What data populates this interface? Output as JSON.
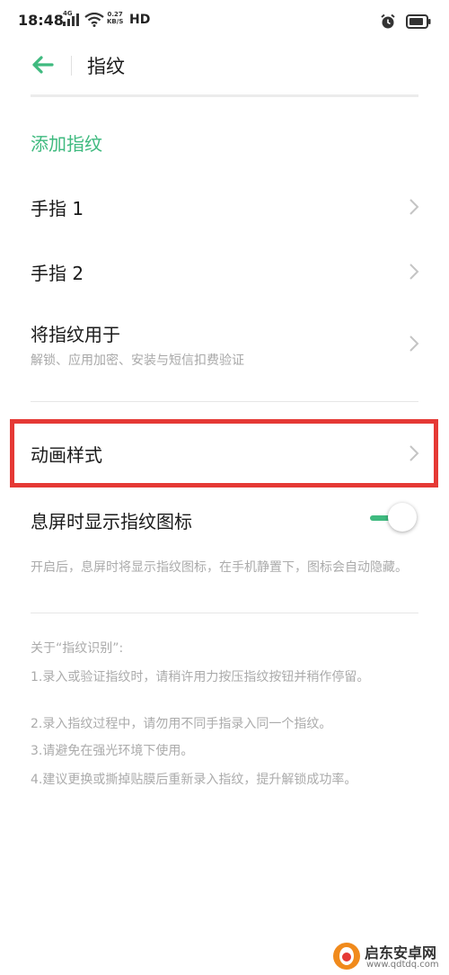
{
  "status_bar": {
    "time": "18:48",
    "network": "4G",
    "speed_value": "0.27",
    "speed_unit": "KB/S",
    "hd": "HD"
  },
  "header": {
    "title": "指纹"
  },
  "add_fingerprint_label": "添加指纹",
  "items": [
    {
      "label": "手指 1"
    },
    {
      "label": "手指 2"
    },
    {
      "label": "将指纹用于",
      "sub": "解锁、应用加密、安装与短信扣费验证"
    },
    {
      "label": "动画样式"
    }
  ],
  "toggle_row": {
    "label": "息屏时显示指纹图标",
    "enabled": true,
    "description": "开启后，息屏时将显示指纹图标，在手机静置下，图标会自动隐藏。"
  },
  "about": {
    "title": "关于“指纹识别”:",
    "tips": [
      "1.录入或验证指纹时，请稍许用力按压指纹按钮并稍作停留。",
      "2.录入指纹过程中，请勿用不同手指录入同一个指纹。",
      "3.请避免在强光环境下使用。",
      "4.建议更换或撕掉贴膜后重新录入指纹，提升解锁成功率。"
    ]
  },
  "watermark": {
    "name": "启东安卓网",
    "url": "www.qdtdq.com"
  },
  "colors": {
    "accent": "#3fba7f",
    "highlight": "#e53935",
    "secondary_text": "#a8a8a8"
  }
}
